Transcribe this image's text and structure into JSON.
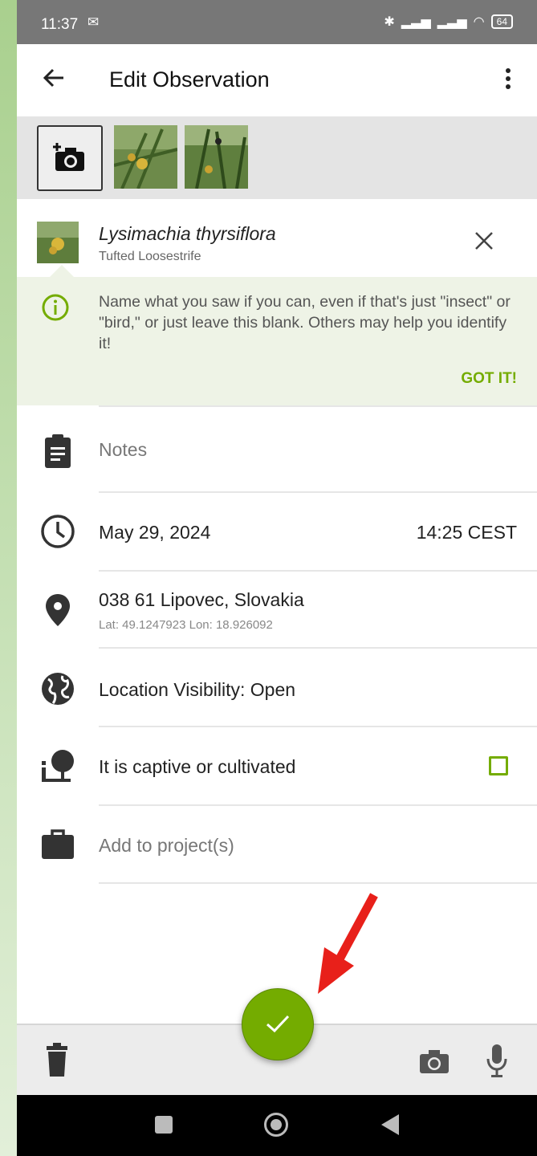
{
  "status_bar": {
    "time": "11:37",
    "battery": "64"
  },
  "appbar": {
    "title": "Edit Observation"
  },
  "taxon": {
    "scientific_name": "Lysimachia thyrsiflora",
    "common_name": "Tufted Loosestrife"
  },
  "hint": {
    "text": "Name what you saw if you can, even if that's just \"insect\" or \"bird,\" or just leave this blank. Others may help you identify it!",
    "dismiss_label": "GOT IT!"
  },
  "fields": {
    "notes_placeholder": "Notes",
    "date": "May 29, 2024",
    "time": "14:25 CEST",
    "location_name": "038 61 Lipovec, Slovakia",
    "location_coords": "Lat: 49.1247923 Lon: 18.926092",
    "visibility": "Location Visibility: Open",
    "captive_label": "It is captive or cultivated",
    "captive_checked": false,
    "projects_placeholder": "Add to project(s)"
  },
  "colors": {
    "accent": "#74ac00",
    "annotation_arrow": "#e8201a"
  }
}
